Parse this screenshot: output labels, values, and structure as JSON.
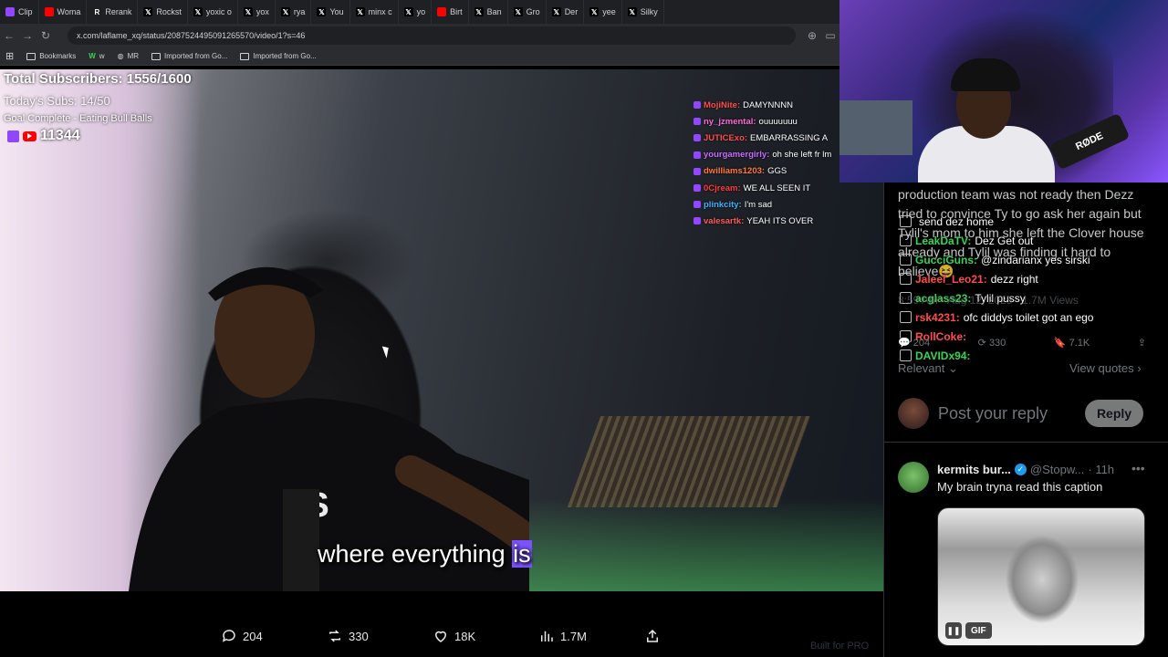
{
  "browser": {
    "tabs": [
      {
        "label": "Clip",
        "icon": "twitch-icon",
        "color": "#9146ff"
      },
      {
        "label": "Woma",
        "icon": "youtube-icon",
        "color": "#ff0000"
      },
      {
        "label": "Rerank",
        "icon": "page-icon",
        "color": "#1f1f1f"
      },
      {
        "label": "Rockst",
        "icon": "x-icon",
        "color": "#000000"
      },
      {
        "label": "yoxic o",
        "icon": "x-icon",
        "color": "#000000"
      },
      {
        "label": "yox",
        "icon": "x-icon",
        "color": "#000000"
      },
      {
        "label": "rya",
        "icon": "x-icon",
        "color": "#000000"
      },
      {
        "label": "You",
        "icon": "x-icon",
        "color": "#000000"
      },
      {
        "label": "minx c",
        "icon": "x-icon",
        "color": "#000000"
      },
      {
        "label": "yo",
        "icon": "x-icon",
        "color": "#000000"
      },
      {
        "label": "Birt",
        "icon": "youtube-icon",
        "color": "#ff0000"
      },
      {
        "label": "Ban",
        "icon": "x-icon",
        "color": "#000000"
      },
      {
        "label": "Gro",
        "icon": "x-icon",
        "color": "#000000"
      },
      {
        "label": "Der",
        "icon": "x-icon",
        "color": "#000000"
      },
      {
        "label": "yee",
        "icon": "x-icon",
        "color": "#000000"
      },
      {
        "label": "Silky",
        "icon": "x-icon",
        "color": "#000000"
      }
    ],
    "url": "x.com/laflame_xq/status/2087524495091265570/video/1?s=46",
    "bookmarks": [
      {
        "label": "Bookmarks",
        "icon": "bookmark-icon"
      },
      {
        "label": "w",
        "icon": "w-icon"
      },
      {
        "label": "MR",
        "icon": "globe-icon"
      },
      {
        "label": "Imported from Go...",
        "icon": "folder-icon"
      },
      {
        "label": "Imported from Go...",
        "icon": "folder-icon"
      }
    ]
  },
  "overlay": {
    "subscribers": "Total Subscribers: 1556/1600",
    "today": "Today's Subs: 14/50",
    "goal": "Goal Complete - Eating Bull Balls",
    "count": "11344"
  },
  "stream_chat": [
    {
      "user": "MojiNite:",
      "msg": "DAMYNNNN",
      "color": "#ff4d4d"
    },
    {
      "user": "ny_jzmental:",
      "msg": "ouuuuuuu",
      "color": "#ff6ad5"
    },
    {
      "user": "JUTICExo:",
      "msg": "EMBARRASSING A",
      "color": "#ff4d4d"
    },
    {
      "user": "yourgamergirly:",
      "msg": "oh she left fr lm",
      "color": "#c86bff"
    },
    {
      "user": "dwilliams1203:",
      "msg": "GGS",
      "color": "#ff7a3d"
    },
    {
      "user": "0Cjream:",
      "msg": "WE ALL SEEN IT",
      "color": "#ff3b3b"
    },
    {
      "user": "plinkcity:",
      "msg": "I'm sad",
      "color": "#3fb0ff"
    },
    {
      "user": "valesartk:",
      "msg": "YEAH ITS OVER",
      "color": "#ff5a5a"
    }
  ],
  "video": {
    "caption_pre": "where everything ",
    "caption_hl": "is"
  },
  "actions": {
    "replies": "204",
    "reposts": "330",
    "likes": "18K",
    "views": "1.7M"
  },
  "webcam": {
    "mic_brand": "RØDE"
  },
  "tweet": {
    "text": "production team was not ready then Dezz tried to convince Ty to go ask her again but Tylil's mom to him she left the Clover house already and Tylil was finding it hard to believe😆",
    "meta": "8:59 AM · Aug 12, 2025 · 1.7M Views",
    "stat_replies": "204",
    "stat_reposts": "330",
    "bookmarks": "7.1K",
    "sort": "Relevant",
    "view_quotes": "View quotes"
  },
  "side_chat": [
    {
      "user": "",
      "msg": "send dez home",
      "color": "#ffffff"
    },
    {
      "user": "LeakDaTV:",
      "msg": "Dez Get out",
      "color": "#39d353"
    },
    {
      "user": "GucciGuns:",
      "msg": "@zindarianx yes sirski",
      "color": "#39d353"
    },
    {
      "user": "Jaleel_Leo21:",
      "msg": "dezz right",
      "color": "#ff4d4d"
    },
    {
      "user": "acglass23:",
      "msg": "Tylil pussy",
      "color": "#39d353"
    },
    {
      "user": "rsk4231:",
      "msg": "ofc diddys toilet got an ego",
      "color": "#ff4d4d"
    },
    {
      "user": "RollCoke:",
      "msg": "",
      "color": "#ff4d4d"
    },
    {
      "user": "DAVIDx94:",
      "msg": "",
      "color": "#39d353"
    }
  ],
  "reply_box": {
    "placeholder": "Post your reply",
    "button": "Reply"
  },
  "comment": {
    "name": "kermits bur...",
    "handle": "@Stopw...",
    "time": "· 11h",
    "text": "My brain tryna read this caption",
    "media_badge": "GIF"
  },
  "footer_hint": "Built for PRO"
}
